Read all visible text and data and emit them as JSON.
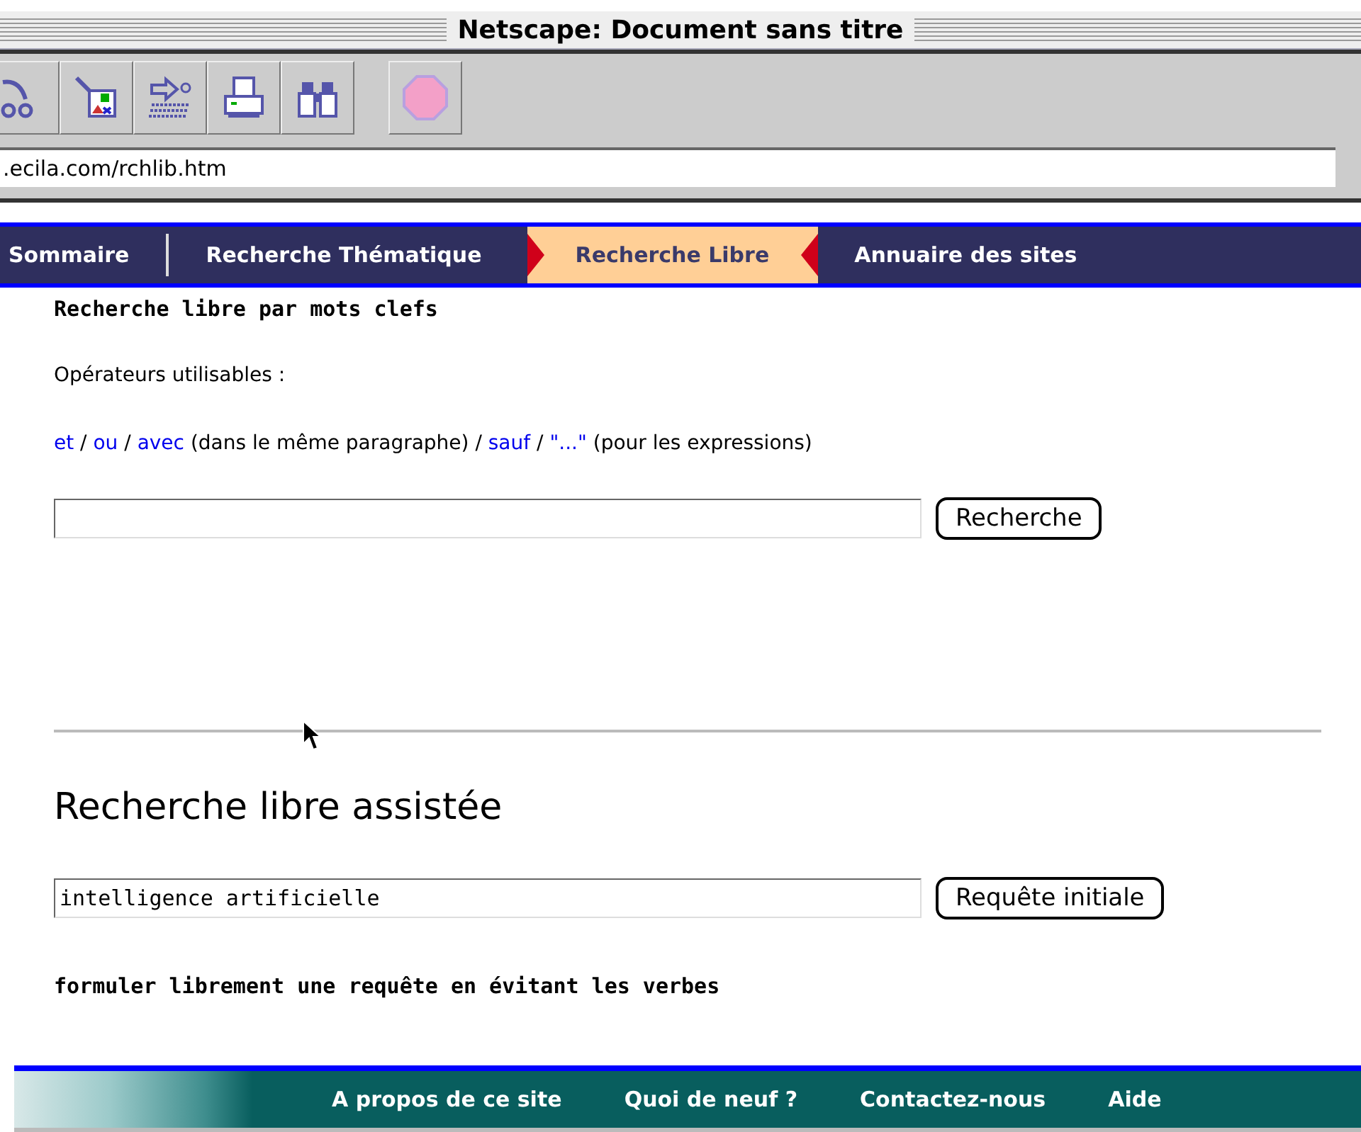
{
  "window": {
    "title": "Netscape: Document sans titre"
  },
  "location": {
    "value": ".ecila.com/rchlib.htm"
  },
  "nav": [
    {
      "label": "Sommaire",
      "selected": false
    },
    {
      "label": "Recherche Thématique",
      "selected": false
    },
    {
      "label": "Recherche Libre",
      "selected": true
    },
    {
      "label": "Annuaire des sites",
      "selected": false
    }
  ],
  "keyword_search": {
    "heading": "Recherche libre par mots clefs",
    "intro": "Opérateurs utilisables :",
    "operators": [
      {
        "kind": "link",
        "text": "et"
      },
      {
        "kind": "text",
        "text": " / "
      },
      {
        "kind": "link",
        "text": "ou"
      },
      {
        "kind": "text",
        "text": " / "
      },
      {
        "kind": "link",
        "text": "avec"
      },
      {
        "kind": "text",
        "text": " (dans le même paragraphe) / "
      },
      {
        "kind": "link",
        "text": "sauf"
      },
      {
        "kind": "text",
        "text": " / "
      },
      {
        "kind": "link",
        "text": "\"...\""
      },
      {
        "kind": "text",
        "text": " (pour les expressions)"
      }
    ],
    "button": "Recherche"
  },
  "assisted_search": {
    "heading": "Recherche libre assistée",
    "value": "intelligence artificielle",
    "button": "Requête initiale",
    "hint": "formuler librement une requête en évitant les verbes"
  },
  "footer": [
    "A propos de ce site",
    "Quoi de neuf ?",
    "Contactez-nous",
    "Aide"
  ]
}
